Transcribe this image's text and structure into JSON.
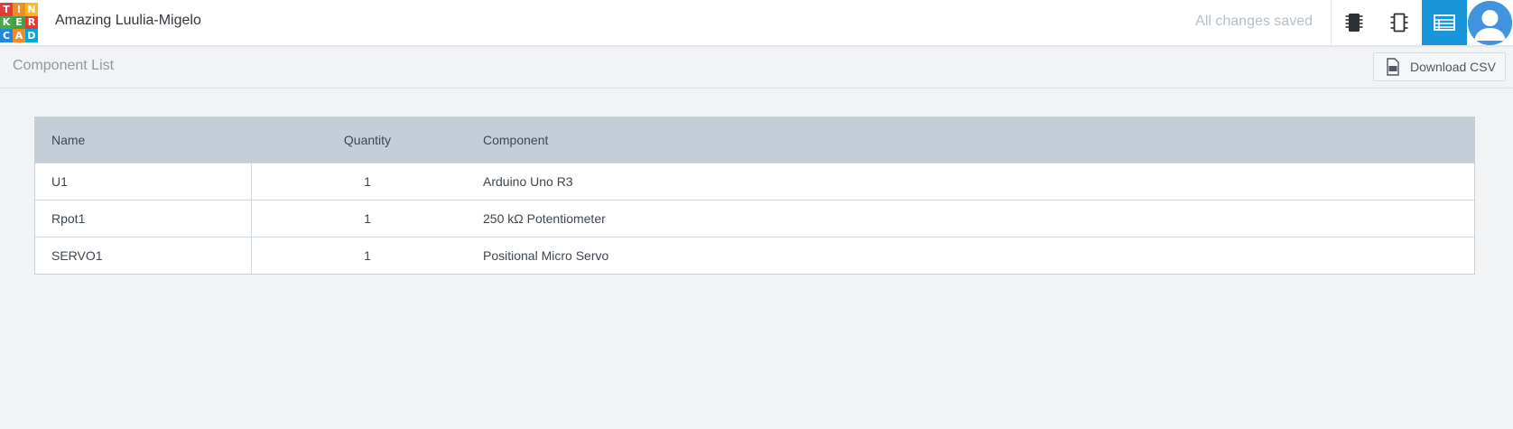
{
  "app": {
    "logo_letters": [
      "T",
      "I",
      "N",
      "K",
      "E",
      "R",
      "C",
      "A",
      "D"
    ],
    "logo_colors": [
      "#e53935",
      "#f28b25",
      "#fbb820",
      "#48a947",
      "#43a047",
      "#e53935",
      "#1e88e5",
      "#f28b25",
      "#00a8de"
    ],
    "project_title": "Amazing Luulia-Migelo",
    "save_status": "All changes saved",
    "accent_color": "#1896d9"
  },
  "toolbar": {
    "buttons": [
      {
        "name": "components-view-button",
        "icon": "chip-icon"
      },
      {
        "name": "schematic-view-button",
        "icon": "ic-outline-icon"
      },
      {
        "name": "component-list-button",
        "icon": "list-table-icon",
        "active": true
      }
    ]
  },
  "subheader": {
    "title": "Component List",
    "download_label": "Download CSV"
  },
  "table": {
    "columns": [
      "Name",
      "Quantity",
      "Component"
    ],
    "rows": [
      {
        "name": "U1",
        "quantity": "1",
        "component": "Arduino Uno R3"
      },
      {
        "name": "Rpot1",
        "quantity": "1",
        "component": "250 kΩ Potentiometer"
      },
      {
        "name": "SERVO1",
        "quantity": "1",
        "component": "Positional Micro Servo"
      }
    ]
  }
}
